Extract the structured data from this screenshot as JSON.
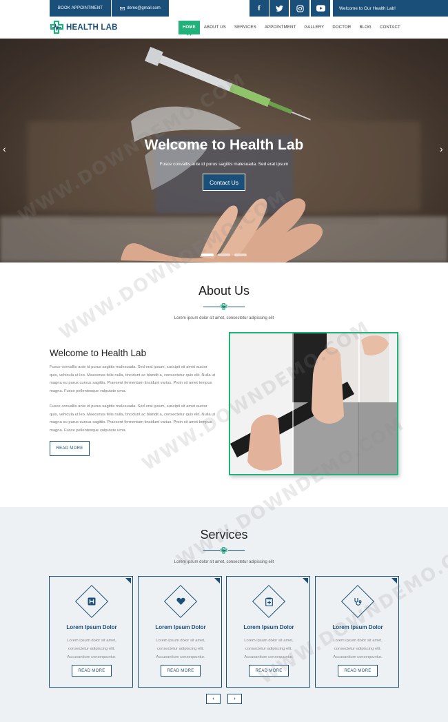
{
  "topbar": {
    "book_label": "BOOK APPOINTMENT",
    "email": "demo@gmail.com",
    "social": [
      {
        "icon": "facebook-icon",
        "glyph": "f"
      },
      {
        "icon": "twitter-icon",
        "glyph": "t"
      },
      {
        "icon": "instagram-icon",
        "glyph": "o"
      },
      {
        "icon": "youtube-icon",
        "glyph": "▶"
      }
    ],
    "welcome": "Welcome to Our Health Lab!"
  },
  "header": {
    "logo_text": "HEALTH LAB",
    "nav": [
      "HOME",
      "ABOUT US",
      "SERVICES",
      "APPOINTMENT",
      "GALLERY",
      "DOCTOR",
      "BLOG",
      "CONTACT"
    ],
    "active_index": 0
  },
  "hero": {
    "title": "Welcome to Health Lab",
    "subtitle": "Fusce convallis ante id purus sagittis malesuada. Sed erat ipsum",
    "button": "Contact Us",
    "prev_arrow": "‹",
    "next_arrow": "›"
  },
  "about": {
    "title": "About Us",
    "subtitle": "Lorem ipsum dolor sit amet, consectetur adipiscing elit",
    "heading": "Welcome to Health Lab",
    "paragraphs": [
      "Fusce convallis ante id purus sagittis malesuada. Sed erat ipsum, suscipit sit amet auctor quis, vehicula ut leo. Maecenas felis nulla, tincidunt ac blandit a, consectetur quis elit. Nulla ut magna eu purus cursus sagittis. Praesent fermentum tincidunt varius. Proin sit amet tempus magna. Fusce pellentesque vulputate urna.",
      "Fusce convallis ante id purus sagittis malesuada. Sed erat ipsum, suscipit sit amet auctor quis, vehicula ut leo. Maecenas felis nulla, tincidunt ac blandit a, consectetur quis elit. Nulla ut magna eu purus cursus sagittis. Praesent fermentum tincidunt varius. Proin sit amet tempus magna. Fusce pellentesque vulputate urna."
    ],
    "button": "READ MORE"
  },
  "services": {
    "title": "Services",
    "subtitle": "Lorem ipsum dolor sit amet, consectetur adipiscing elit",
    "cards": [
      {
        "icon": "hospital-icon",
        "title": "Lorem Ipsum Dolor",
        "text": "Lorem ipsum dolor sit amet, consectetur adipiscing elit. Accusantium consequuntur.",
        "button": "READ MORE"
      },
      {
        "icon": "heart-icon",
        "title": "Lorem Ipsum Dolor",
        "text": "Lorem ipsum dolor sit amet, consectetur adipiscing elit. Accusantium consequuntur.",
        "button": "READ MORE"
      },
      {
        "icon": "clipboard-icon",
        "title": "Lorem Ipsum Dolor",
        "text": "Lorem ipsum dolor sit amet, consectetur adipiscing elit. Accusantium consequuntur.",
        "button": "READ MORE"
      },
      {
        "icon": "stethoscope-icon",
        "title": "Lorem Ipsum Dolor",
        "text": "Lorem ipsum dolor sit amet, consectetur adipiscing elit. Accusantium consequuntur.",
        "button": "READ MORE"
      }
    ],
    "prev": "‹",
    "next": "›"
  },
  "watermark": "WWW.DOWNDEMO.COM",
  "colors": {
    "primary": "#1a4f7a",
    "accent": "#21b27a",
    "section_bg": "#eef1f4"
  }
}
